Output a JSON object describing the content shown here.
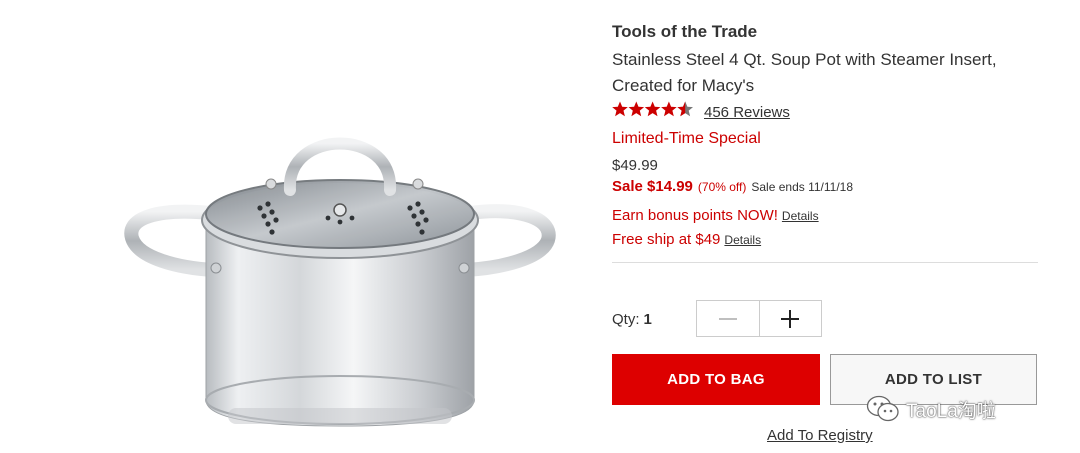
{
  "product": {
    "brand": "Tools of the Trade",
    "title": "Stainless Steel 4 Qt. Soup Pot with Steamer Insert, Created for Macy's",
    "image_alt": "stainless steel soup pot with glass lid",
    "rating": {
      "stars": 4.5,
      "stars_max": 5,
      "reviews_label": "456 Reviews"
    },
    "promo_label": "Limited-Time Special",
    "original_price": "$49.99",
    "sale": {
      "label": "Sale $14.99",
      "percent_off": "(70% off)",
      "ends": "Sale ends 11/11/18"
    },
    "bonus": {
      "text": "Earn bonus points NOW!",
      "link": "Details"
    },
    "shipping": {
      "text": "Free ship at $49",
      "link": "Details"
    }
  },
  "purchase": {
    "qty_label": "Qty:",
    "qty_value": "1",
    "decrement_icon": "minus-icon",
    "increment_icon": "plus-icon",
    "add_to_bag": "ADD TO BAG",
    "add_to_list": "ADD TO LIST",
    "registry": "Add To Registry"
  },
  "watermark": {
    "text": "TaoLa淘啦",
    "icon": "wechat-icon"
  },
  "colors": {
    "accent": "#dd0000",
    "sale_red": "#cc0000",
    "text": "#333333",
    "divider": "#dddddd"
  }
}
